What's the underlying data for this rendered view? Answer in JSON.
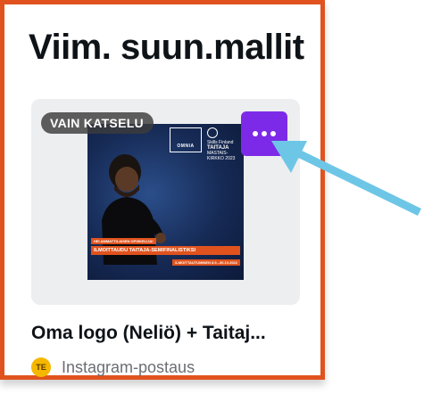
{
  "section": {
    "title": "Viim. suun.mallit"
  },
  "card": {
    "badge": "VAIN KATSELU",
    "title": "Oma logo (Neliö) + Taitaj...",
    "owner_initials": "TE",
    "type": "Instagram-postaus",
    "more_button_icon": "more-horizontal-icon"
  },
  "preview": {
    "omnia": "OMNIA",
    "taitaja_small": "Skills Finland",
    "taitaja_main": "TAITAJA",
    "taitaja_sub1": "MASTAIS-",
    "taitaja_sub2": "KIRKKO 2023",
    "banner_top": "HEI AMMATTILAISEN OPISKELIJA!",
    "banner_mid": "ILMOITTAUDU TAITAJA-SEMIFINALISTIKSI",
    "banner_bottom": "ILMOITTAUTUMINEN 8.9.–30.10.2022"
  },
  "colors": {
    "frame_border": "#e0531e",
    "more_button": "#7d2ae8",
    "arrow": "#6ec6e6",
    "avatar": "#f5b700"
  }
}
